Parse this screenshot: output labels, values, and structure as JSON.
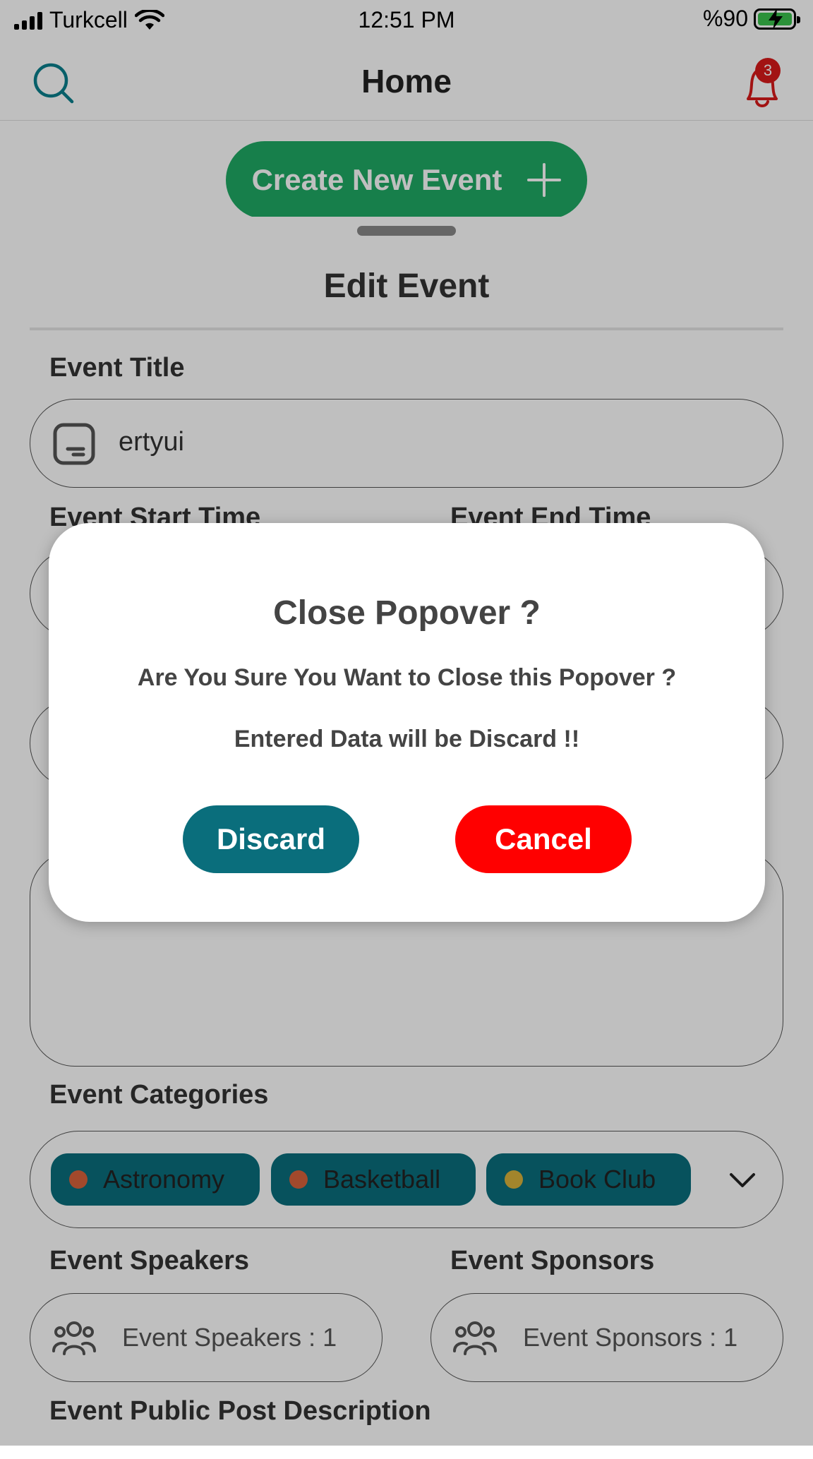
{
  "status_bar": {
    "carrier": "Turkcell",
    "time": "12:51 PM",
    "battery": "%90"
  },
  "header": {
    "title": "Home",
    "notification_count": "3",
    "search_icon": "search-icon",
    "bell_icon": "bell-icon"
  },
  "create_button": {
    "label": "Create New Event"
  },
  "sheet": {
    "title": "Edit Event",
    "event_title_label": "Event Title",
    "event_title_value": "ertyui",
    "start_time_label": "Event Start Time",
    "end_time_label": "Event End Time",
    "categories_label": "Event Categories",
    "categories": [
      {
        "name": "Astronomy",
        "color": "#d9623b"
      },
      {
        "name": "Basketball",
        "color": "#d9623b"
      },
      {
        "name": "Book Club",
        "color": "#d9b23b"
      }
    ],
    "speakers_label": "Event Speakers",
    "speakers_value": "Event Speakers : 1",
    "sponsors_label": "Event Sponsors",
    "sponsors_value": "Event Sponsors : 1",
    "public_post_label": "Event Public Post Description"
  },
  "dialog": {
    "title": "Close Popover ?",
    "message": "Are You Sure You Want to Close this Popover ?",
    "warning": "Entered Data will be Discard !!",
    "discard_label": "Discard",
    "cancel_label": "Cancel"
  },
  "colors": {
    "primary": "#0a6e7c",
    "create_green": "#1faa64",
    "cancel_red": "#ff0000",
    "badge_red": "#d91a1a"
  }
}
